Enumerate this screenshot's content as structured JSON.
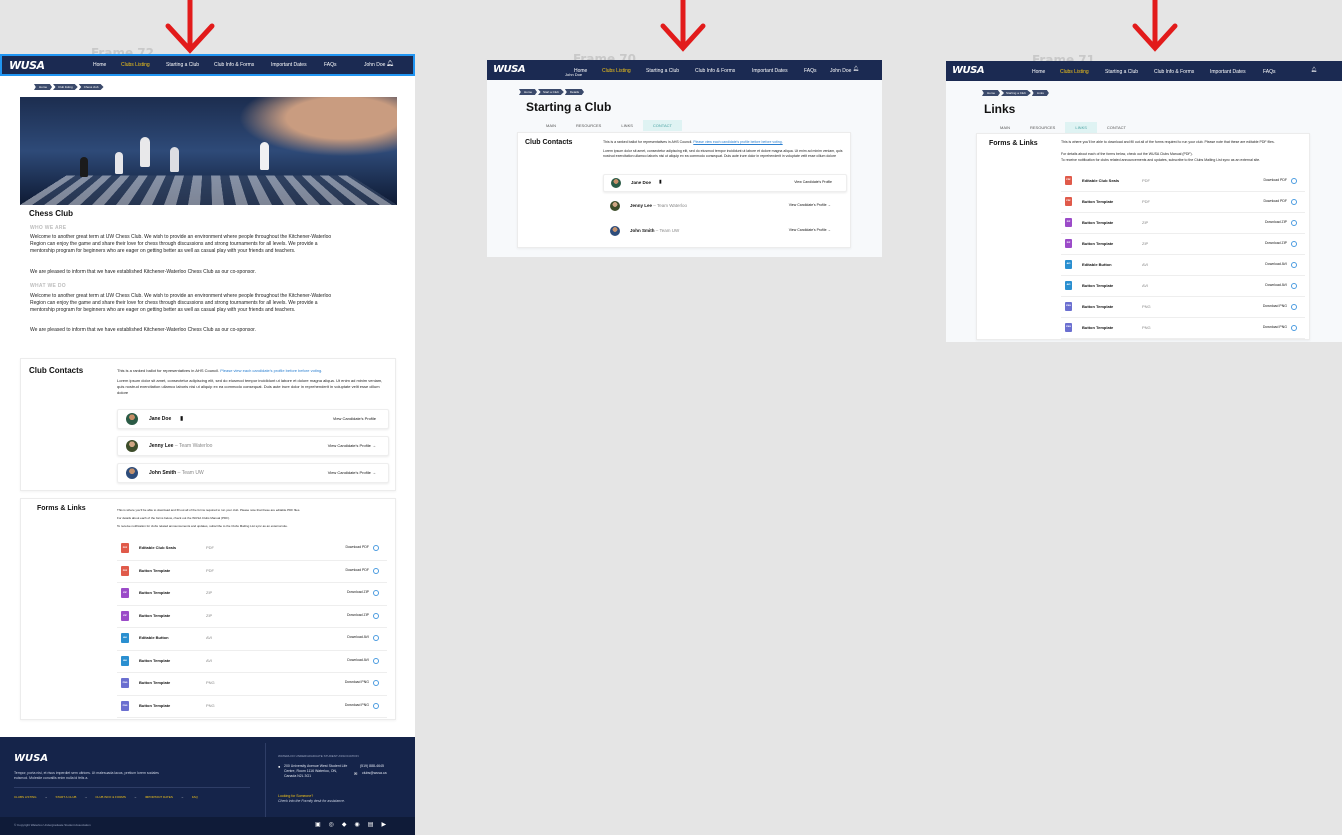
{
  "frames": {
    "a": "Frame 72",
    "b": "Frame 70",
    "c": "Frame 71"
  },
  "nav": {
    "logo": "WUSA",
    "home": "Home",
    "clubs": "Clubs Listing",
    "starting": "Starting a Club",
    "info": "Club Info & Forms",
    "dates": "Important Dates",
    "faqs": "FAQs",
    "user": "John Doe"
  },
  "breadcrumbs": [
    "Home",
    "Club listing",
    "Chess club"
  ],
  "breadcrumbs_b": [
    "Home",
    "Start a Club",
    "Details"
  ],
  "breadcrumbs_c": [
    "Home",
    "Starting a Club",
    "Links"
  ],
  "club": {
    "title": "Chess Club",
    "who_heading": "WHO WE ARE",
    "who_p1": "Welcome to another great term at UW Chess Club. We wish to provide an environment where people throughout the Kitchener-Waterloo Region can enjoy the game and share their love for chess through discussions and strong tournaments for all levels. We provide a mentorship program for beginners who are eager on getting better as well as casual play with your friends and teachers.",
    "who_p2": "We are pleased to inform that we have established Kitchener-Waterloo Chess Club as our co-sponsor.",
    "what_heading": "WHAT WE DO",
    "what_p1": "Welcome to another great term at UW Chess Club. We wish to provide an environment where people throughout the Kitchener-Waterloo Region can enjoy the game and share their love for chess through discussions and strong tournaments for all levels. We provide a mentorship program for beginners who are eager on getting better as well as casual play with your friends and teachers.",
    "what_p2": "We are pleased to inform that we have established Kitchener-Waterloo Chess Club as our co-sponsor."
  },
  "contacts": {
    "heading": "Club Contacts",
    "intro": "This is a ranked ballot for representatives in AHS Council.",
    "intro_link": "Please view each candidate's profile before before voting.",
    "lorem": "Lorem ipsum dolor sit amet, consectetur adipiscing elit, sed do eiusmod tempor incididunt ut labore et dolore magna aliqua. Ut enim ad minim veniam, quis nostrud exercitation ullamco laboris nisi ut aliquip ex ea commodo consequat. Duis aute irure dolor in reprehenderit in voluptate velit esse cillum dolore",
    "people": [
      {
        "name": "Jane Doe",
        "team": "",
        "link": "View Candidate's Profile"
      },
      {
        "name": "Jenny Lee",
        "team": "Team Waterloo",
        "link": "View Candidate's Profile"
      },
      {
        "name": "John Smith",
        "team": "Team UW",
        "link": "View Candidate's Profile"
      }
    ]
  },
  "forms": {
    "heading": "Forms & Links",
    "p1": "This is where you'll be able to download and fill out all of the forms required to run your club. Please note that these are editable PDF files.",
    "p2": "For details about each of the forms below, check out the WUSA Clubs Manual (PDF).",
    "p3": "To receive notification for clubs related announcements and updates, subscribe to the Clubs Mailing List sync as an external site.",
    "files": [
      {
        "name": "Editable Club Seals",
        "type": "PDF",
        "action": "Download PDF",
        "color": "#e05a4a",
        "ext": "PDF"
      },
      {
        "name": "Button Template",
        "type": "PDF",
        "action": "Download PDF",
        "color": "#e05a4a",
        "ext": "PDF"
      },
      {
        "name": "Button Template",
        "type": "ZIP",
        "action": "Download ZIP",
        "color": "#9b4bc8",
        "ext": "ZIP"
      },
      {
        "name": "Button Template",
        "type": "ZIP",
        "action": "Download ZIP",
        "color": "#9b4bc8",
        "ext": "ZIP"
      },
      {
        "name": "Editable Button",
        "type": "AVI",
        "action": "Download AVI",
        "color": "#2a8fd0",
        "ext": "AVI"
      },
      {
        "name": "Button Template",
        "type": "AVI",
        "action": "Download AVI",
        "color": "#2a8fd0",
        "ext": "AVI"
      },
      {
        "name": "Button Template",
        "type": "PNG",
        "action": "Download PNG",
        "color": "#6b6fd0",
        "ext": "PNG"
      },
      {
        "name": "Button Template",
        "type": "PNG",
        "action": "Download PNG",
        "color": "#6b6fd0",
        "ext": "PNG"
      }
    ],
    "files_c": [
      {
        "name": "Editable Club Seals",
        "type": "PDF"
      },
      {
        "name": "Button Template",
        "type": "PDF"
      },
      {
        "name": "Button Template",
        "type": "ZIP"
      },
      {
        "name": "Button Template",
        "type": "ZIP"
      },
      {
        "name": "Editable Button",
        "type": "AVI"
      },
      {
        "name": "Button Template",
        "type": "AVI"
      },
      {
        "name": "Button Template",
        "type": "PNG"
      },
      {
        "name": "Button Template",
        "type": "PNG"
      }
    ]
  },
  "starting": {
    "title": "Starting a Club",
    "tabs": [
      "MAIN",
      "RESOURCES",
      "LINKS",
      "CONTACT"
    ]
  },
  "links": {
    "title": "Links",
    "tabs": [
      "MAIN",
      "RESOURCES",
      "LINKS",
      "CONTACT"
    ]
  },
  "footer": {
    "blurb": "Tempor, porta nisi, et risus imperdiet sem ultrices. Ut malesuada lacus, pretium lorem sodales euismod. Molestie convallis enim nulla id felis a.",
    "links": [
      "CLUBS LISTING",
      "START A CLUB",
      "CLUB INFO & FORMS",
      "IMPORTANT DATES",
      "FAQ"
    ],
    "org": "WATERLOO UNDERGRADUATE STUDENT ASSOCIATION",
    "address": "200 University Avenue West Student Life Centre, Room 1116 Waterloo, ON, Canada N2L 3G1",
    "phone": "(519) 888-4645",
    "email": "clubs@wusa.ca",
    "looking": "Looking for Someone?",
    "looking_sub": "Check into the Formity desk for assistance.",
    "copyright": "© Copyright Waterloo Undergraduate Student Association"
  },
  "colors": {
    "navy": "#1b2a52",
    "accent": "#f5c518",
    "arrow": "#e21b1b",
    "selection": "#2196f3"
  }
}
